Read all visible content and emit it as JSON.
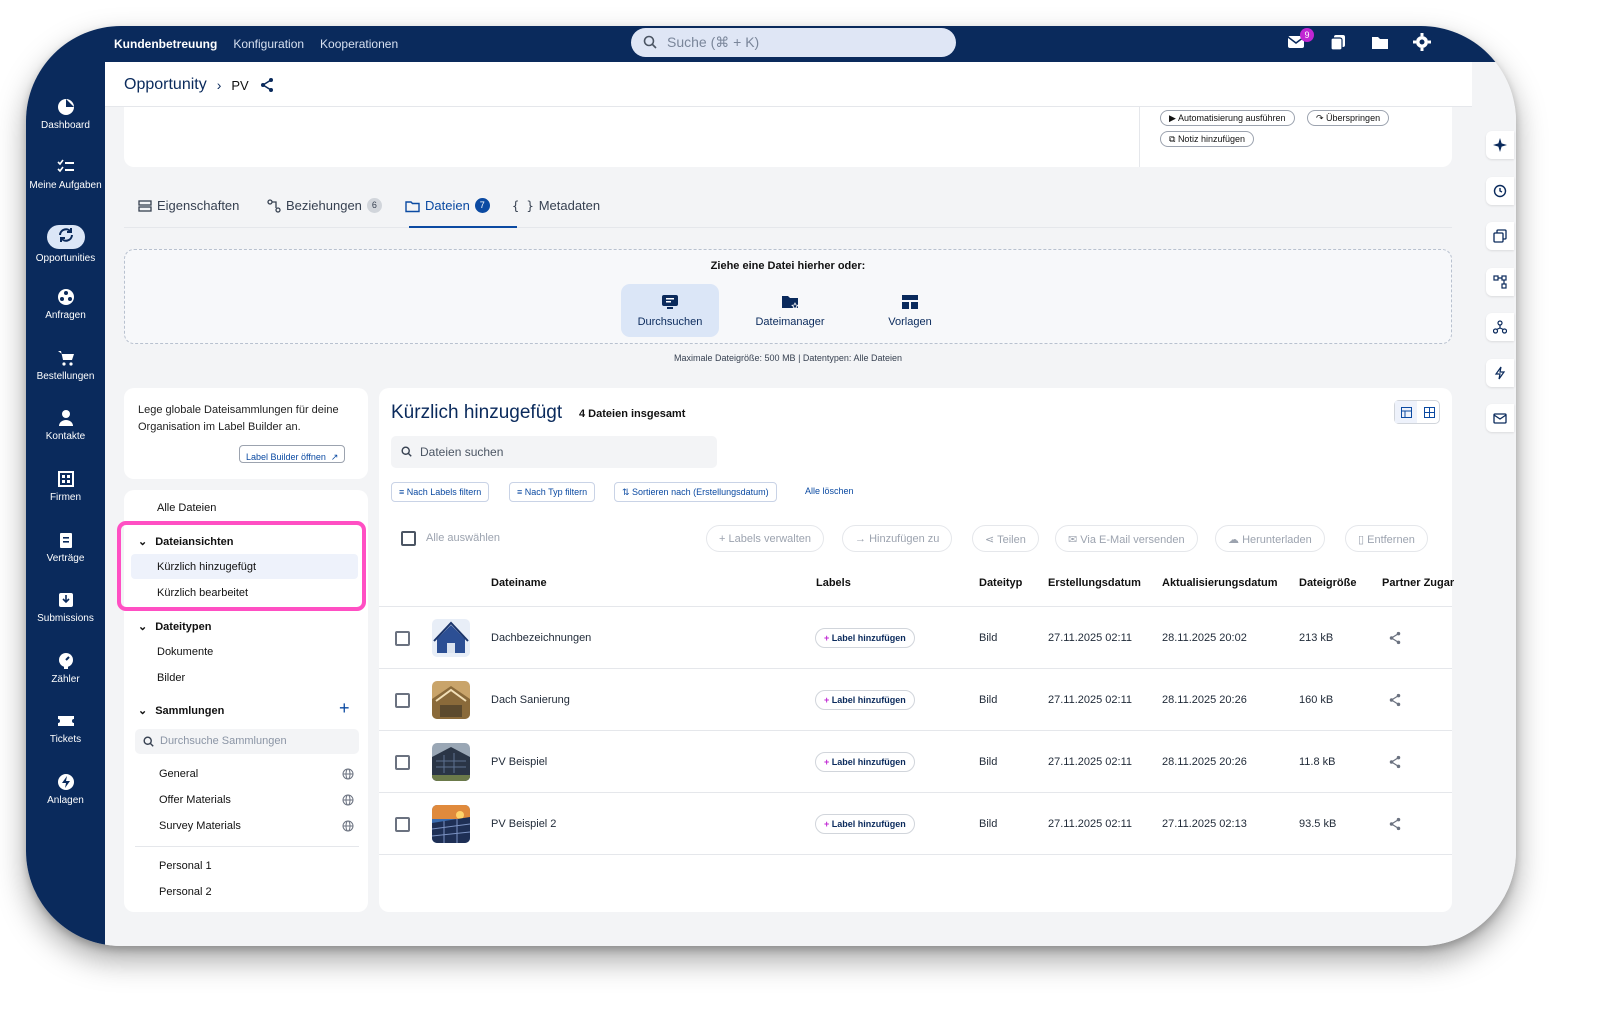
{
  "topbar": {
    "nav": [
      "Kundenbetreuung",
      "Konfiguration",
      "Kooperationen"
    ],
    "search_placeholder": "Suche (⌘ + K)",
    "mail_badge": "9"
  },
  "sidebar": {
    "items": [
      {
        "label": "Dashboard",
        "icon": "dashboard-icon"
      },
      {
        "label": "Meine Aufgaben",
        "icon": "tasks-icon"
      },
      {
        "label": "Opportunities",
        "icon": "sync-icon"
      },
      {
        "label": "Anfragen",
        "icon": "inquiry-icon"
      },
      {
        "label": "Bestellungen",
        "icon": "cart-icon"
      },
      {
        "label": "Kontakte",
        "icon": "person-icon"
      },
      {
        "label": "Firmen",
        "icon": "building-icon"
      },
      {
        "label": "Verträge",
        "icon": "clipboard-icon"
      },
      {
        "label": "Submissions",
        "icon": "inbox-icon"
      },
      {
        "label": "Zähler",
        "icon": "meter-icon"
      },
      {
        "label": "Tickets",
        "icon": "ticket-icon"
      },
      {
        "label": "Anlagen",
        "icon": "bolt-icon"
      }
    ]
  },
  "breadcrumb": {
    "root": "Opportunity",
    "current": "PV"
  },
  "topcard": {
    "automation_label": "Automatisierung ausführen",
    "skip_label": "Überspringen",
    "note_label": "Notiz hinzufügen"
  },
  "tabs": [
    {
      "label": "Eigenschaften"
    },
    {
      "label": "Beziehungen",
      "count": "6"
    },
    {
      "label": "Dateien",
      "count": "7"
    },
    {
      "label": "Metadaten"
    }
  ],
  "dropzone": {
    "title": "Ziehe eine Datei hierher oder:",
    "buttons": [
      "Durchsuchen",
      "Dateimanager",
      "Vorlagen"
    ],
    "note": "Maximale Dateigröße: 500 MB  |  Datentypen: Alle Dateien"
  },
  "info": {
    "text": "Lege globale Dateisammlungen für deine Organisation im Label Builder an.",
    "button": "Label Builder öffnen"
  },
  "tree": {
    "all_files": "Alle Dateien",
    "views_heading": "Dateiansichten",
    "views": [
      "Kürzlich hinzugefügt",
      "Kürzlich bearbeitet"
    ],
    "types_heading": "Dateitypen",
    "types": [
      "Dokumente",
      "Bilder"
    ],
    "collections_heading": "Sammlungen",
    "collections_search": "Durchsuche Sammlungen",
    "collections": [
      "General",
      "Offer Materials",
      "Survey Materials"
    ],
    "personal": [
      "Personal 1",
      "Personal 2"
    ]
  },
  "files": {
    "title": "Kürzlich hinzugefügt",
    "count": "4 Dateien insgesamt",
    "search_placeholder": "Dateien suchen",
    "filters": [
      "Nach Labels filtern",
      "Nach Typ filtern",
      "Sortieren nach (Erstellungsdatum)"
    ],
    "clear_all": "Alle löschen",
    "select_all": "Alle auswählen",
    "actions": [
      "Labels verwalten",
      "Hinzufügen zu",
      "Teilen",
      "Via E-Mail versenden",
      "Herunterladen",
      "Entfernen"
    ],
    "columns": [
      "Dateiname",
      "Labels",
      "Dateityp",
      "Erstellungsdatum",
      "Aktualisierungsdatum",
      "Dateigröße",
      "Partner Zugar"
    ],
    "add_label": "Label hinzufügen",
    "rows": [
      {
        "name": "Dachbezeichnungen",
        "type": "Bild",
        "created": "27.11.2025 02:11",
        "updated": "28.11.2025 20:02",
        "size": "213 kB"
      },
      {
        "name": "Dach Sanierung",
        "type": "Bild",
        "created": "27.11.2025 02:11",
        "updated": "28.11.2025 20:26",
        "size": "160 kB"
      },
      {
        "name": "PV Beispiel",
        "type": "Bild",
        "created": "27.11.2025 02:11",
        "updated": "28.11.2025 20:26",
        "size": "11.8 kB"
      },
      {
        "name": "PV Beispiel 2",
        "type": "Bild",
        "created": "27.11.2025 02:11",
        "updated": "27.11.2025 02:13",
        "size": "93.5 kB"
      }
    ]
  },
  "colors": {
    "navy": "#0a2a5c",
    "accent": "#0b4aa2",
    "highlight": "#ff4fc3"
  }
}
